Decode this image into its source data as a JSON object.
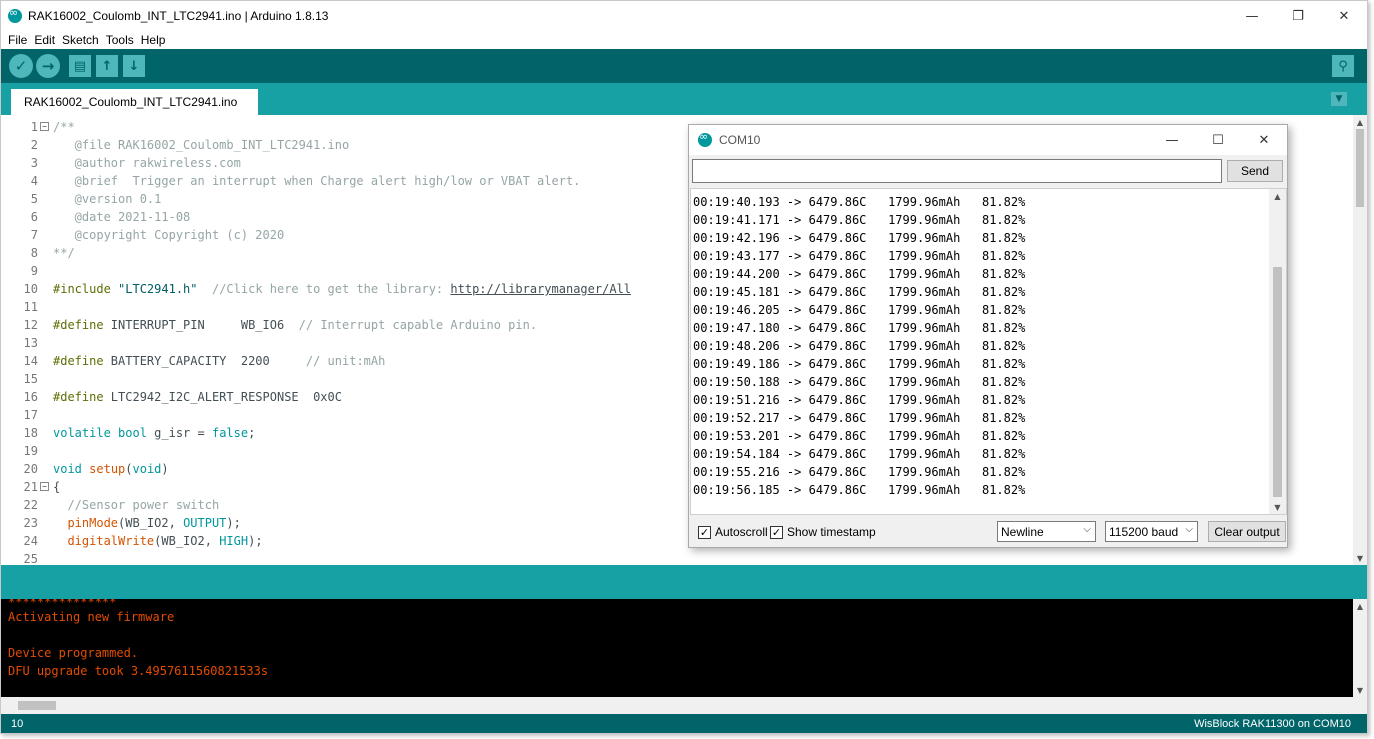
{
  "window": {
    "title": "RAK16002_Coulomb_INT_LTC2941.ino | Arduino 1.8.13",
    "minimize": "—",
    "maximize": "❐",
    "close": "✕"
  },
  "menu": [
    "File",
    "Edit",
    "Sketch",
    "Tools",
    "Help"
  ],
  "toolbar": {
    "verify": "✓",
    "upload": "→",
    "new": "▤",
    "open": "↑",
    "save": "↓",
    "serial_monitor": "⚲"
  },
  "tab": {
    "label": "RAK16002_Coulomb_INT_LTC2941.ino",
    "menu_arrow": "▼"
  },
  "editor": {
    "line_numbers": [
      "1",
      "2",
      "3",
      "4",
      "5",
      "6",
      "7",
      "8",
      "9",
      "10",
      "11",
      "12",
      "13",
      "14",
      "15",
      "16",
      "17",
      "18",
      "19",
      "20",
      "21",
      "22",
      "23",
      "24",
      "25"
    ],
    "fold_marks": {
      "line1": "−",
      "line21": "−"
    },
    "lines": {
      "l1": "/**",
      "l2": "   @file RAK16002_Coulomb_INT_LTC2941.ino",
      "l3": "   @author rakwireless.com",
      "l4": "   @brief  Trigger an interrupt when Charge alert high/low or VBAT alert.",
      "l5": "   @version 0.1",
      "l6": "   @date 2021-11-08",
      "l7": "   @copyright Copyright (c) 2020",
      "l8": "**/",
      "l10_pp": "#include ",
      "l10_str": "\"LTC2941.h\"",
      "l10_cm": "  //Click here to get the library: ",
      "l10_link": "http://librarymanager/All",
      "l12_pp": "#define ",
      "l12_rest": "INTERRUPT_PIN     WB_IO6  ",
      "l12_cm": "// Interrupt capable Arduino pin.",
      "l14_pp": "#define ",
      "l14_rest": "BATTERY_CAPACITY  2200     ",
      "l14_cm": "// unit:mAh",
      "l16_pp": "#define ",
      "l16_rest": "LTC2942_I2C_ALERT_RESPONSE  0x0C",
      "l18_kw1": "volatile",
      "l18_kw2": "bool",
      "l18_rest1": " g_isr = ",
      "l18_kw3": "false",
      "l18_rest2": ";",
      "l20_kw1": "void",
      "l20_fn": "setup",
      "l20_kw2": "void",
      "l21": "{",
      "l22_cm": "  //Sensor power switch",
      "l23_fn": "pinMode",
      "l23_rest": "(WB_IO2, ",
      "l23_kw": "OUTPUT",
      "l23_end": ");",
      "l24_fn": "digitalWrite",
      "l24_rest": "(WB_IO2, ",
      "l24_kw": "HIGH",
      "l24_end": ");"
    },
    "scroll_up": "▲",
    "scroll_down": "▼"
  },
  "console": {
    "lines": [
      "***************",
      "Activating new firmware",
      "",
      "Device programmed.",
      "DFU upgrade took 3.4957611560821533s"
    ]
  },
  "footer": {
    "line_number": "10",
    "board": "WisBlock RAK11300 on COM10"
  },
  "serial_monitor": {
    "title": "COM10",
    "input_value": "",
    "send_label": "Send",
    "output": [
      "00:19:40.193 -> 6479.86C   1799.96mAh   81.82%",
      "00:19:41.171 -> 6479.86C   1799.96mAh   81.82%",
      "00:19:42.196 -> 6479.86C   1799.96mAh   81.82%",
      "00:19:43.177 -> 6479.86C   1799.96mAh   81.82%",
      "00:19:44.200 -> 6479.86C   1799.96mAh   81.82%",
      "00:19:45.181 -> 6479.86C   1799.96mAh   81.82%",
      "00:19:46.205 -> 6479.86C   1799.96mAh   81.82%",
      "00:19:47.180 -> 6479.86C   1799.96mAh   81.82%",
      "00:19:48.206 -> 6479.86C   1799.96mAh   81.82%",
      "00:19:49.186 -> 6479.86C   1799.96mAh   81.82%",
      "00:19:50.188 -> 6479.86C   1799.96mAh   81.82%",
      "00:19:51.216 -> 6479.86C   1799.96mAh   81.82%",
      "00:19:52.217 -> 6479.86C   1799.96mAh   81.82%",
      "00:19:53.201 -> 6479.86C   1799.96mAh   81.82%",
      "00:19:54.184 -> 6479.86C   1799.96mAh   81.82%",
      "00:19:55.216 -> 6479.86C   1799.96mAh   81.82%",
      "00:19:56.185 -> 6479.86C   1799.96mAh   81.82%"
    ],
    "autoscroll_label": "Autoscroll",
    "autoscroll_checked": true,
    "timestamp_label": "Show timestamp",
    "timestamp_checked": true,
    "check_mark": "✓",
    "line_ending": "Newline",
    "baud": "115200 baud",
    "clear_label": "Clear output",
    "dropdown_arrow": "⌵"
  },
  "colors": {
    "toolbar": "#006468",
    "tabbar": "#17a1a5",
    "console_text": "#e34c00",
    "accent": "#00979d"
  }
}
